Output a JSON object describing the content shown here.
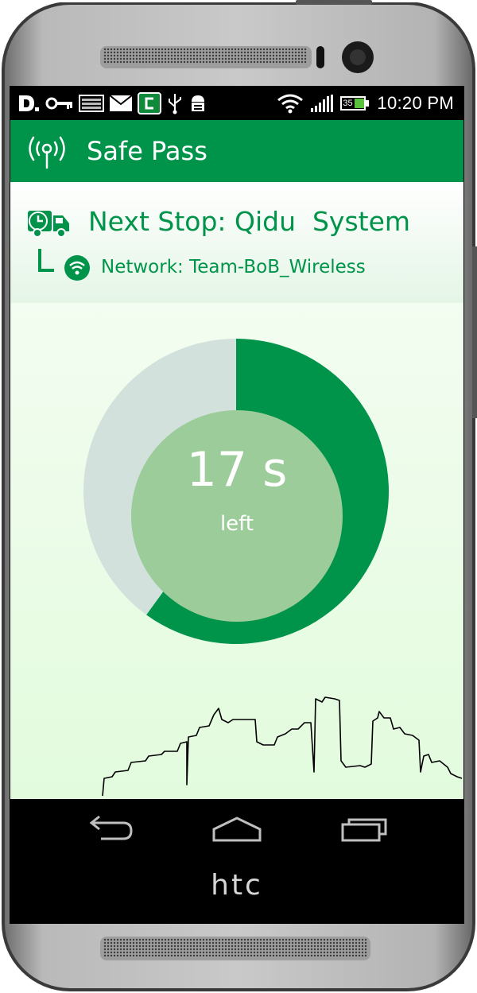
{
  "device": {
    "brand": "htc"
  },
  "status_bar": {
    "time": "10:20 PM",
    "battery_level": "35",
    "left_icons": [
      "carrier-d-icon",
      "key-icon",
      "image-icon",
      "mail-icon",
      "app-c-icon",
      "usb-icon",
      "android-debug-icon"
    ],
    "right_icons": [
      "wifi-icon",
      "signal-icon",
      "battery-icon"
    ]
  },
  "app_bar": {
    "title": "Safe Pass",
    "icon": "radio-tower-icon"
  },
  "stop": {
    "title": "Next Stop: Qidu  System",
    "network": "Network: Team-BoB_Wireless"
  },
  "timer": {
    "value": "17 s",
    "label": "left",
    "remaining_fraction": 0.6
  },
  "colors": {
    "primary": "#00944a",
    "gauge_track": "#d3e1dd",
    "gauge_inner": "#9ccc9a",
    "background": "#e6fbe4"
  },
  "nav": [
    "back-icon",
    "home-icon",
    "recents-icon"
  ]
}
